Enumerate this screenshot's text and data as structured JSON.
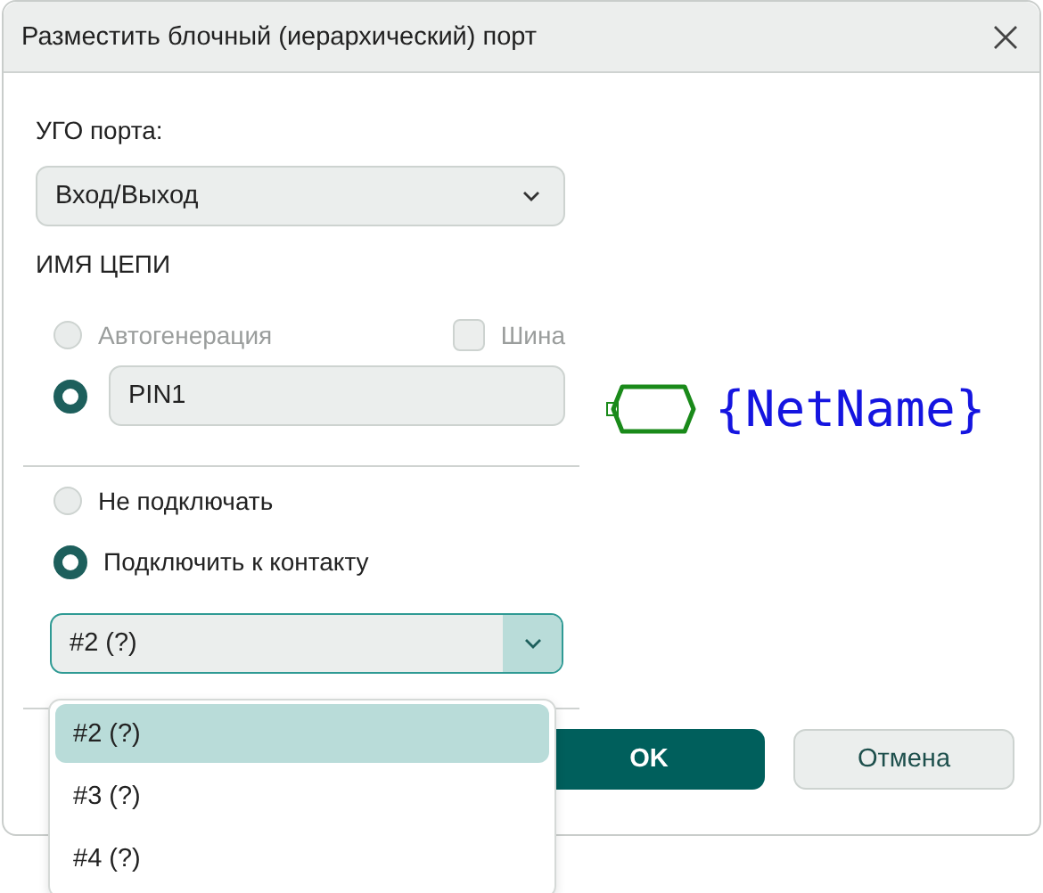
{
  "window": {
    "title": "Разместить блочный (иерархический) порт"
  },
  "port_symbol": {
    "label": "УГО порта:",
    "value": "Вход/Выход"
  },
  "net_name": {
    "heading": "ИМЯ ЦЕПИ",
    "autogen": {
      "label": "Автогенерация",
      "selected": false,
      "disabled": true
    },
    "bus": {
      "label": "Шина",
      "checked": false,
      "disabled": true
    },
    "manual": {
      "selected": true,
      "value": "PIN1"
    }
  },
  "preview": {
    "text": "{NetName}"
  },
  "connection": {
    "options": [
      {
        "label": "Не подключать",
        "selected": false
      },
      {
        "label": "Подключить к контакту",
        "selected": true
      }
    ],
    "pin": {
      "value": "#2 (?)",
      "expanded": true,
      "items": [
        {
          "label": "#2 (?)",
          "selected": true
        },
        {
          "label": "#3 (?)",
          "selected": false
        },
        {
          "label": "#4 (?)",
          "selected": false
        }
      ]
    }
  },
  "buttons": [
    {
      "label": "OK",
      "kind": "primary"
    },
    {
      "label": "Отмена",
      "kind": "secondary"
    }
  ]
}
